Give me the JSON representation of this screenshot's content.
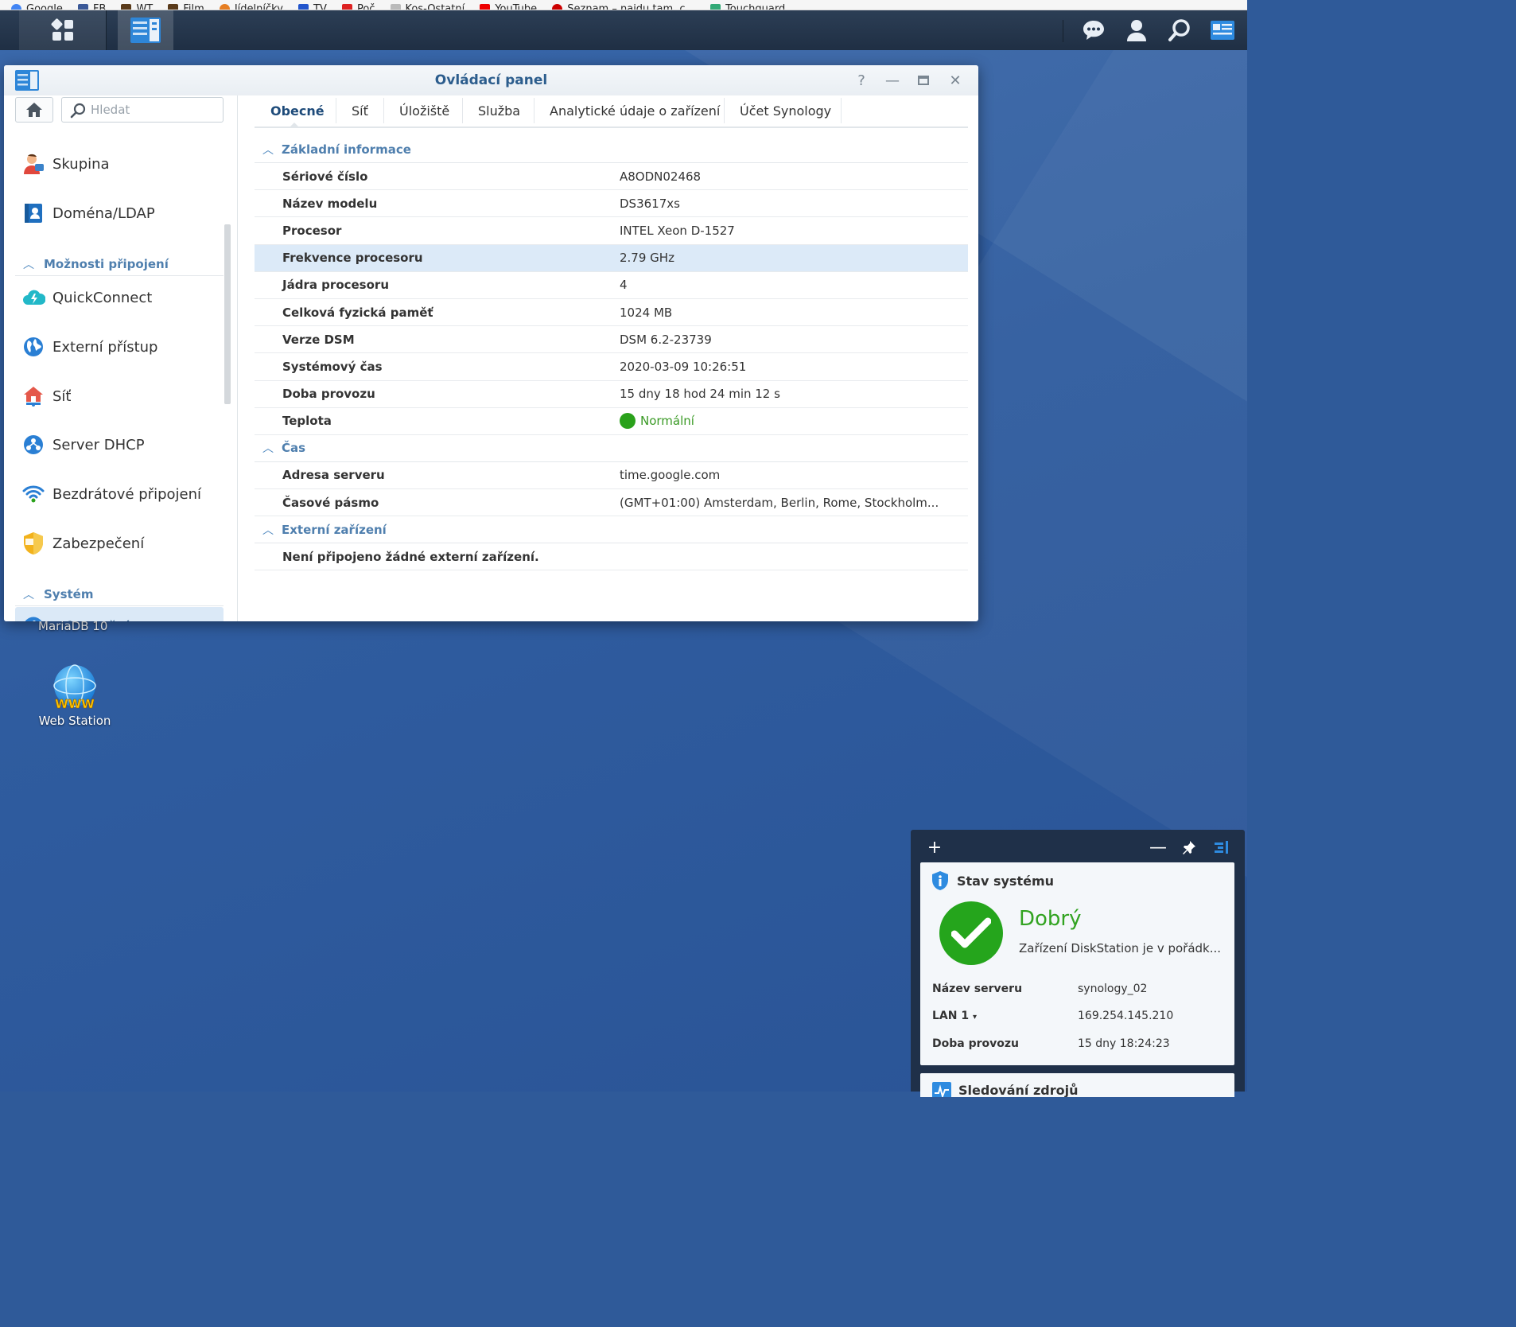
{
  "bookmarks": [
    "Google",
    "FB",
    "WT",
    "Film",
    "Jídelníčky",
    "TV",
    "Poč",
    "Kos-Ostatní",
    "YouTube",
    "Seznam – najdu tam, c...",
    "Touchguard"
  ],
  "window": {
    "title": "Ovládací panel",
    "help": "?",
    "minimize": "—",
    "close": "✕"
  },
  "sidebar": {
    "search_placeholder": "Hledat",
    "items": [
      {
        "label": "Skupina",
        "icon": "group-icon"
      },
      {
        "label": "Doména/LDAP",
        "icon": "domain-icon"
      },
      {
        "section": "Možnosti připojení"
      },
      {
        "label": "QuickConnect",
        "icon": "quickconnect-icon"
      },
      {
        "label": "Externí přístup",
        "icon": "globe-icon"
      },
      {
        "label": "Síť",
        "icon": "network-house-icon"
      },
      {
        "label": "Server DHCP",
        "icon": "dhcp-icon"
      },
      {
        "label": "Bezdrátové připojení",
        "icon": "wifi-icon"
      },
      {
        "label": "Zabezpečení",
        "icon": "shield-icon"
      },
      {
        "section": "Systém"
      },
      {
        "label": "Informační centrum",
        "icon": "info-icon"
      }
    ]
  },
  "tabs": [
    "Obecné",
    "Síť",
    "Úložiště",
    "Služba",
    "Analytické údaje o zařízení",
    "Účet Synology"
  ],
  "sections": {
    "basic": {
      "title": "Základní informace",
      "rows": [
        {
          "key": "Sériové číslo",
          "value": "A8ODN02468"
        },
        {
          "key": "Název modelu",
          "value": "DS3617xs"
        },
        {
          "key": "Procesor",
          "value": "INTEL Xeon D-1527"
        },
        {
          "key": "Frekvence procesoru",
          "value": "2.79 GHz"
        },
        {
          "key": "Jádra procesoru",
          "value": "4"
        },
        {
          "key": "Celková fyzická paměť",
          "value": "1024 MB"
        },
        {
          "key": "Verze DSM",
          "value": "DSM 6.2-23739"
        },
        {
          "key": "Systémový čas",
          "value": "2020-03-09 10:26:51"
        },
        {
          "key": "Doba provozu",
          "value": "15 dny 18 hod 24 min 12 s"
        },
        {
          "key": "Teplota",
          "value": "Normální"
        }
      ]
    },
    "time": {
      "title": "Čas",
      "rows": [
        {
          "key": "Adresa serveru",
          "value": "time.google.com"
        },
        {
          "key": "Časové pásmo",
          "value": "(GMT+01:00) Amsterdam, Berlin, Rome, Stockholm..."
        }
      ]
    },
    "external": {
      "title": "Externí zařízení",
      "message": "Není připojeno žádné externí zařízení."
    }
  },
  "desktop": {
    "cut_label": "MariaDB 10",
    "web_station_icon_text": "WWW",
    "web_station_label": "Web Station"
  },
  "widget": {
    "title": "Stav systému",
    "status": "Dobrý",
    "description": "Zařízení DiskStation je v pořádk...",
    "rows": [
      {
        "key": "Název serveru",
        "value": "synology_02"
      },
      {
        "key": "LAN 1",
        "value": "169.254.145.210"
      },
      {
        "key": "Doba provozu",
        "value": "15 dny 18:24:23"
      }
    ],
    "next_title": "Sledování zdrojů"
  },
  "colors": {
    "accent": "#4f7fae",
    "status_ok": "#2aa11b",
    "taskbar": "#24364d",
    "desktop": "#2f5a99"
  }
}
